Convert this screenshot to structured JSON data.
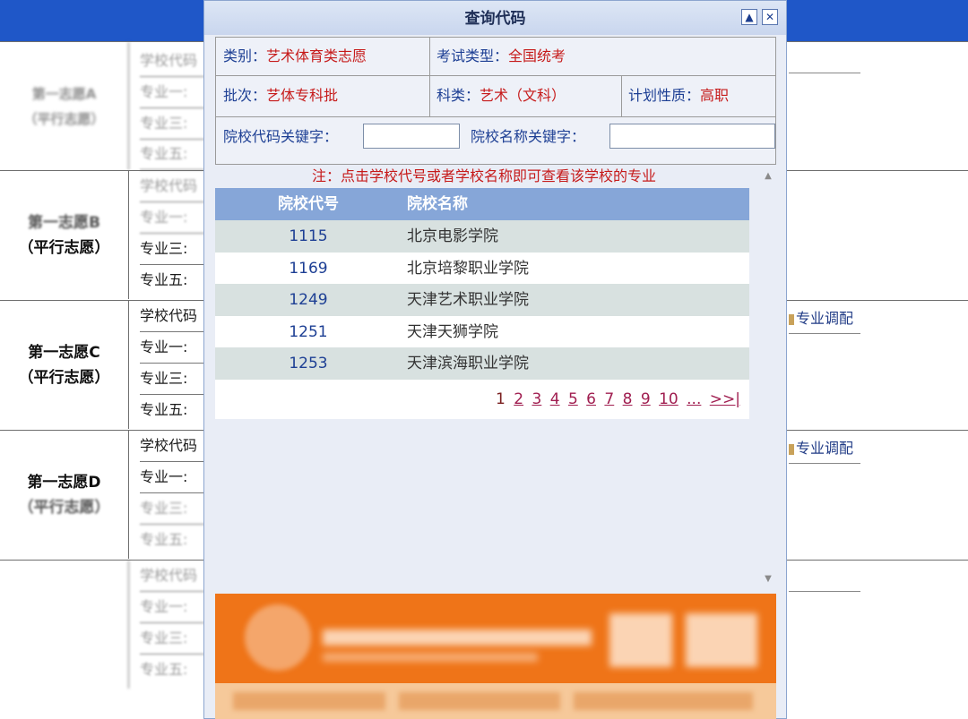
{
  "background": {
    "rows": [
      {
        "label_lines": [
          "第一志愿A",
          "（平行志愿）"
        ],
        "fields": [
          "学校代码",
          "专业一:",
          "专业三:",
          "专业五:"
        ],
        "blurred": true
      },
      {
        "label_lines": [
          "第一志愿B",
          "（平行志愿）"
        ],
        "fields": [
          "学校代码",
          "专业一:",
          "专业三:",
          "专业五:"
        ],
        "blurred_partial": true
      },
      {
        "label_lines": [
          "第一志愿C",
          "（平行志愿）"
        ],
        "fields": [
          "学校代码",
          "专业一:",
          "专业三:",
          "专业五:"
        ],
        "right_text": "专业调配"
      },
      {
        "label_lines": [
          "第一志愿D",
          "（平行志愿）"
        ],
        "fields": [
          "学校代码",
          "专业一:",
          "专业三:",
          "专业五:"
        ],
        "right_text": "专业调配"
      },
      {
        "label_lines": [
          "",
          ""
        ],
        "fields": [
          "学校代码",
          "专业一:",
          "专业三:",
          "专业五:"
        ],
        "blurred": true
      }
    ]
  },
  "modal": {
    "title": "查询代码",
    "min_icon": "chevron-up-icon",
    "close_icon": "close-icon",
    "filters": {
      "category_label": "类别：",
      "category_value": "艺术体育类志愿",
      "exam_type_label": "考试类型：",
      "exam_type_value": "全国统考",
      "batch_label": "批次：",
      "batch_value": "艺体专科批",
      "subject_label": "科类：",
      "subject_value": "艺术（文科）",
      "plan_label": "计划性质：",
      "plan_value": "高职",
      "code_keyword_label": "院校代码关键字：",
      "name_keyword_label": "院校名称关键字："
    },
    "note": "注：点击学校代号或者学校名称即可查看该学校的专业",
    "table": {
      "headers": [
        "院校代号",
        "院校名称"
      ],
      "rows": [
        {
          "code": "1115",
          "name": "北京电影学院"
        },
        {
          "code": "1169",
          "name": "北京培黎职业学院"
        },
        {
          "code": "1249",
          "name": "天津艺术职业学院"
        },
        {
          "code": "1251",
          "name": "天津天狮学院"
        },
        {
          "code": "1253",
          "name": "天津滨海职业学院"
        }
      ]
    },
    "pager": {
      "current": "1",
      "pages": [
        "2",
        "3",
        "4",
        "5",
        "6",
        "7",
        "8",
        "9",
        "10",
        "...",
        ">>|"
      ]
    }
  },
  "colors": {
    "topbar": "#1f57c8",
    "accent_red": "#c61a1a",
    "label_blue": "#1d3f94",
    "table_header": "#86a6d8",
    "banner_orange": "#ef7418"
  }
}
